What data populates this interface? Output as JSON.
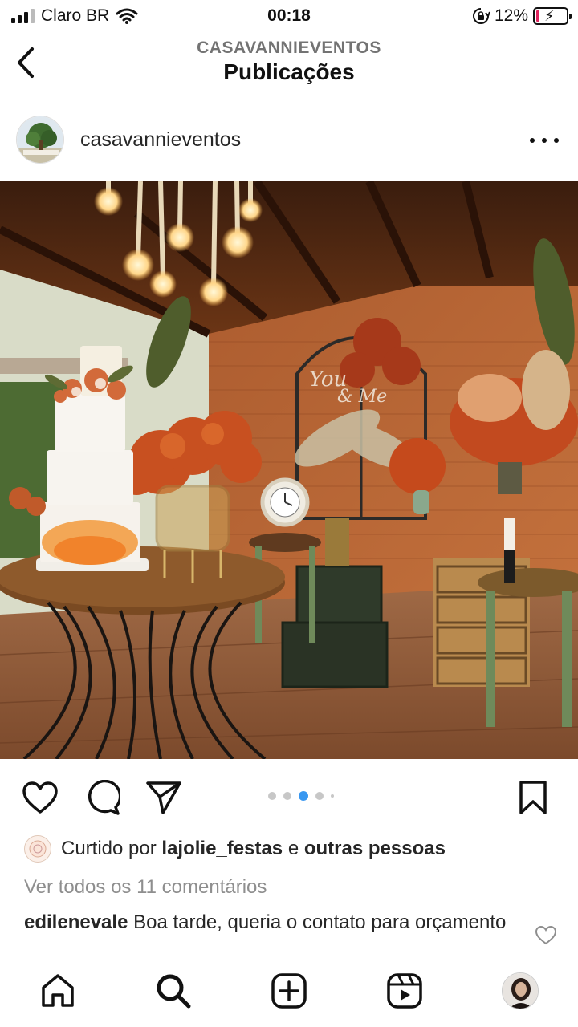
{
  "status_bar": {
    "carrier": "Claro BR",
    "time": "00:18",
    "battery": "12%",
    "battery_level": 0.12
  },
  "header": {
    "account": "CASAVANNIEVENTOS",
    "title": "Publicações"
  },
  "post": {
    "username": "casavannieventos",
    "carousel": {
      "count": 5,
      "active_index": 2
    },
    "likes": {
      "prefix": "Curtido por",
      "user": "lajolie_festas",
      "joiner": "e",
      "others": "outras pessoas"
    },
    "view_comments": "Ver todos os 11 comentários",
    "comment": {
      "user": "edilenevale",
      "text": "Boa tarde, queria o contato para orçamento"
    }
  },
  "colors": {
    "accent": "#3897f0",
    "text": "#262626",
    "muted": "#8e8e8e",
    "divider": "#dbdbdb"
  },
  "icons": {
    "status": [
      "signal-icon",
      "wifi-icon",
      "lock-rotation-icon",
      "battery-icon"
    ],
    "header": [
      "back-chevron-icon"
    ],
    "actions": [
      "heart-icon",
      "comment-icon",
      "send-icon",
      "bookmark-icon"
    ],
    "tabs": [
      "home-icon",
      "search-icon",
      "new-post-icon",
      "reels-icon",
      "profile-avatar"
    ]
  }
}
